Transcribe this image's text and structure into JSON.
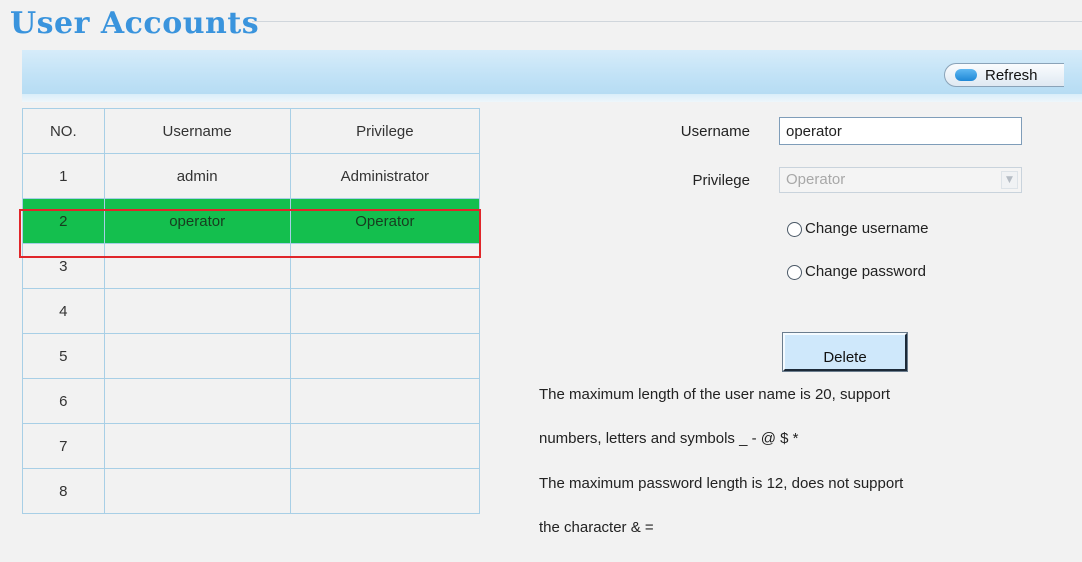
{
  "page": {
    "title": "User Accounts"
  },
  "toolbar": {
    "refresh_label": "Refresh"
  },
  "table": {
    "columns": [
      "NO.",
      "Username",
      "Privilege"
    ],
    "rows": [
      {
        "no": "1",
        "username": "admin",
        "privilege": "Administrator"
      },
      {
        "no": "2",
        "username": "operator",
        "privilege": "Operator"
      },
      {
        "no": "3",
        "username": "",
        "privilege": ""
      },
      {
        "no": "4",
        "username": "",
        "privilege": ""
      },
      {
        "no": "5",
        "username": "",
        "privilege": ""
      },
      {
        "no": "6",
        "username": "",
        "privilege": ""
      },
      {
        "no": "7",
        "username": "",
        "privilege": ""
      },
      {
        "no": "8",
        "username": "",
        "privilege": ""
      }
    ],
    "selected_row": "2"
  },
  "form": {
    "username_label": "Username",
    "username_value": "operator",
    "privilege_label": "Privilege",
    "privilege_value": "Operator",
    "change_username_label": "Change username",
    "change_password_label": "Change password",
    "delete_label": "Delete"
  },
  "notes": {
    "line1": "The maximum length of the user name is 20, support",
    "line2": "numbers, letters and symbols _ - @ $ *",
    "line3": "The maximum password length is 12, does not support",
    "line4": "the character & ="
  },
  "colors": {
    "title": "#3a94dd",
    "selected_row": "#14bf4e",
    "highlight_border": "#e0262a",
    "table_border": "#a8cfe6"
  }
}
